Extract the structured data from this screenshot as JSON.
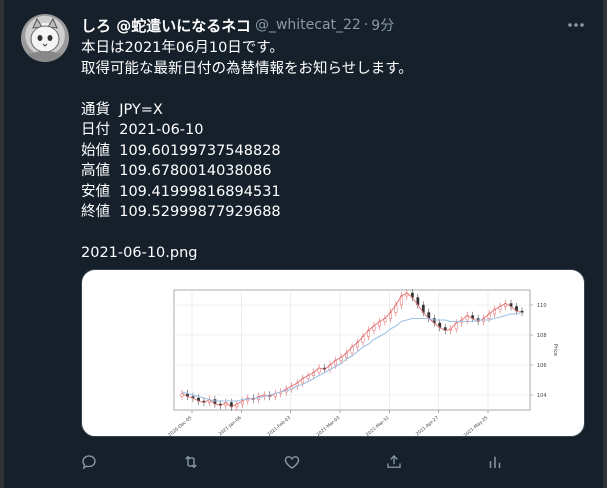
{
  "tweet": {
    "display_name": "しろ @蛇遣いになるネコ",
    "handle": "@_whitecat_22",
    "separator": "·",
    "time": "9分",
    "lines": [
      "本日は2021年06月10日です。",
      "取得可能な最新日付の為替情報をお知らせします。",
      "",
      "通貨  JPY=X",
      "日付  2021-06-10",
      "始値  109.60199737548828",
      "高値  109.6780014038086",
      "安値  109.41999816894531",
      "終値  109.52999877929688",
      "",
      "2021-06-10.png"
    ]
  },
  "icons": {
    "more": "more-horizontal-icon",
    "reply": "reply-icon",
    "retweet": "retweet-icon",
    "like": "heart-icon",
    "share": "share-icon",
    "analytics": "analytics-icon"
  },
  "colors": {
    "background": "#15202b",
    "secondary_text": "#8899a6",
    "candle_up": "#e04848",
    "candle_down": "#333333",
    "ma_short": "#e07070",
    "ma_long": "#9ec3e6"
  },
  "chart_data": {
    "type": "line",
    "x_tick_labels": [
      "2020-Dec-05",
      "2021-Jan-06",
      "2021-Feb-03",
      "2021-Mar-03",
      "2021-Mar-31",
      "2021-Apr-27",
      "2021-May-25"
    ],
    "y_tick_labels": [
      "104",
      "106",
      "108",
      "110"
    ],
    "ylabel": "Price",
    "ylim": [
      103.0,
      111.0
    ],
    "grid": true,
    "series": [
      {
        "values": [
          104.1,
          103.9,
          103.8,
          103.6,
          103.5,
          103.7,
          103.4,
          103.3,
          103.5,
          103.2,
          103.4,
          103.6,
          103.8,
          103.7,
          103.9,
          104.0,
          103.9,
          104.1,
          104.2,
          104.4,
          104.6,
          104.8,
          105.1,
          105.3,
          105.5,
          105.8,
          105.7,
          106.0,
          106.3,
          106.5,
          106.8,
          107.2,
          107.5,
          107.9,
          108.3,
          108.6,
          108.9,
          109.1,
          109.5,
          110.0,
          110.6,
          110.8,
          110.5,
          110.0,
          109.5,
          109.1,
          108.8,
          108.5,
          108.3,
          108.4,
          108.8,
          109.0,
          109.3,
          109.1,
          108.9,
          109.1,
          109.4,
          109.7,
          109.9,
          110.1,
          109.9,
          109.6,
          109.5
        ]
      },
      {
        "values": [
          104.2,
          104.1,
          104.0,
          103.9,
          103.8,
          103.7,
          103.6,
          103.6,
          103.6,
          103.6,
          103.6,
          103.7,
          103.7,
          103.8,
          103.8,
          103.9,
          104.0,
          104.1,
          104.2,
          104.3,
          104.4,
          104.6,
          104.7,
          104.9,
          105.1,
          105.3,
          105.5,
          105.7,
          105.9,
          106.1,
          106.4,
          106.6,
          106.9,
          107.2,
          107.4,
          107.7,
          107.9,
          108.1,
          108.4,
          108.6,
          108.9,
          109.0,
          109.1,
          109.1,
          109.1,
          109.1,
          109.0,
          109.0,
          109.0,
          108.9,
          108.9,
          108.9,
          108.9,
          108.9,
          109.0,
          109.0,
          109.0,
          109.1,
          109.2,
          109.3,
          109.4,
          109.4,
          109.5
        ]
      }
    ]
  }
}
